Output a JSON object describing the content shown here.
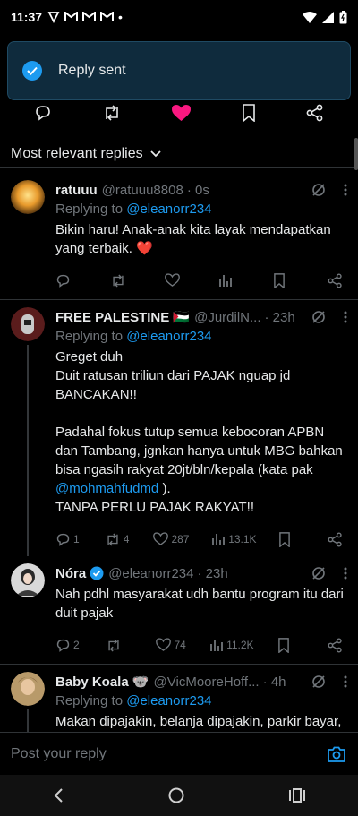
{
  "status_bar": {
    "time": "11:37",
    "dot": "•"
  },
  "toast": {
    "message": "Reply sent",
    "accent": "#1d9bf0"
  },
  "sort": {
    "label": "Most relevant replies"
  },
  "replies": [
    {
      "name": "ratuuu",
      "handle": "@ratuuu8808",
      "time": "· 0s",
      "replying_prefix": "Replying to ",
      "replying_to": "@eleanorr234",
      "text": "Bikin haru! Anak-anak kita layak mendapatkan yang terbaik. ❤️",
      "counts": {
        "replies": "",
        "reposts": "",
        "likes": "",
        "views": ""
      }
    },
    {
      "name": "FREE PALESTINE 🇵🇸",
      "handle": "@JurdilN...",
      "time": "· 23h",
      "replying_prefix": "Replying to ",
      "replying_to": "@eleanorr234",
      "text_a": "Greget duh\nDuit ratusan triliun dari PAJAK nguap jd BANCAKAN!!\n\nPadahal fokus tutup semua kebocoran APBN dan Tambang, jgnkan hanya untuk MBG bahkan bisa ngasih rakyat 20jt/bln/kepala (kata pak ",
      "text_mention": "@mohmahfudmd",
      "text_b": " ).\nTANPA PERLU PAJAK RAKYAT!!",
      "counts": {
        "replies": "1",
        "reposts": "4",
        "likes": "287",
        "views": "13.1K"
      }
    },
    {
      "name": "Nóra",
      "handle": "@eleanorr234",
      "time": "· 23h",
      "text": "Nah pdhl masyarakat udh bantu program itu dari duit pajak",
      "counts": {
        "replies": "2",
        "reposts": "",
        "likes": "74",
        "views": "11.2K"
      }
    },
    {
      "name": "Baby Koala 🐨",
      "handle": "@VicMooreHoff...",
      "time": "· 4h",
      "replying_prefix": "Replying to ",
      "replying_to": "@eleanorr234",
      "text": "Makan dipajakin, belanja dipajakin, parkir bayar, rekreasi, keluar kota, kena retribusi, sekarang program butuh duit dilimpahin ke"
    }
  ],
  "reply_bar": {
    "placeholder": "Post your reply"
  },
  "icons": [
    "check-icon",
    "reply-icon",
    "repost-icon",
    "like-icon",
    "bookmark-icon",
    "share-icon",
    "views-icon",
    "grok-icon",
    "more-icon",
    "camera-icon",
    "chevron-down-icon",
    "back-nav-icon",
    "home-nav-icon",
    "recents-nav-icon"
  ]
}
